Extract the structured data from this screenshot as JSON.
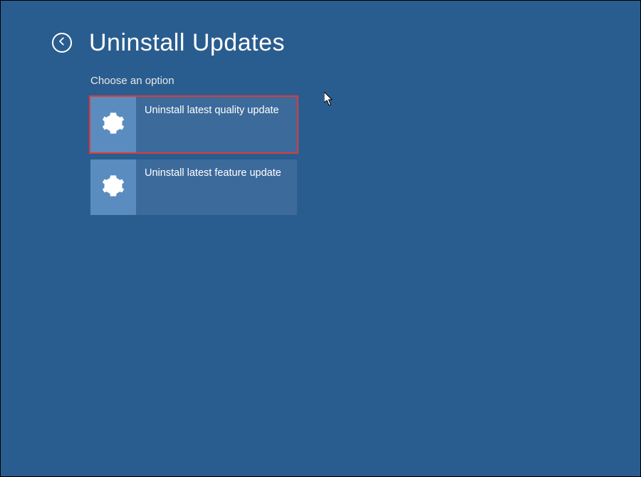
{
  "header": {
    "title": "Uninstall Updates"
  },
  "subtitle": "Choose an option",
  "options": [
    {
      "label": "Uninstall latest quality update",
      "highlighted": true
    },
    {
      "label": "Uninstall latest feature update",
      "highlighted": false
    }
  ],
  "icons": {
    "back": "back-arrow-circle",
    "option": "gear-icon"
  },
  "colors": {
    "background": "#2a5d8f",
    "tile": "#3c6a9b",
    "tile_icon_bg": "#5a8cbf",
    "highlight_outline": "#e03a3a",
    "text": "#ffffff"
  }
}
